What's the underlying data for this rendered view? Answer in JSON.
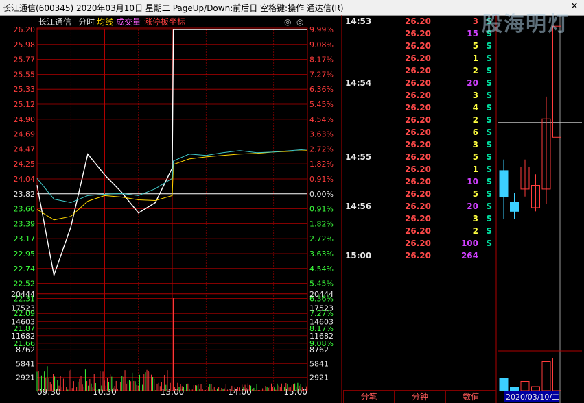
{
  "window": {
    "title": "长江通信(600345)  2020年03月10日 星期二  PageUp/Down:前后日 空格键:操作 通达信(R)",
    "close_glyph": "✕"
  },
  "legend": {
    "name": "长江通信",
    "time_share": "分时",
    "avg_line": "均线",
    "volume": "成交量",
    "limit_axis": "涨停板坐标",
    "icon_glyph": "◎"
  },
  "price_axis_left": [
    "26.20",
    "25.98",
    "25.77",
    "25.55",
    "25.33",
    "25.12",
    "24.90",
    "24.69",
    "24.47",
    "24.25",
    "24.04",
    "23.82",
    "23.60",
    "23.39",
    "23.17",
    "22.95",
    "22.74",
    "22.52",
    "22.31",
    "22.09",
    "21.87",
    "21.66"
  ],
  "pct_axis_right": [
    "9.99%",
    "9.08%",
    "8.17%",
    "7.27%",
    "6.36%",
    "5.45%",
    "4.54%",
    "3.63%",
    "2.72%",
    "1.82%",
    "0.91%",
    "0.00%",
    "0.91%",
    "1.82%",
    "2.72%",
    "3.63%",
    "4.54%",
    "5.45%",
    "6.36%",
    "7.27%",
    "8.17%",
    "9.08%"
  ],
  "volume_axis": [
    "20444",
    "17523",
    "14603",
    "11682",
    "8762",
    "5841",
    "2921"
  ],
  "time_axis": [
    "09:30",
    "10:30",
    "13:00",
    "14:00",
    "15:00"
  ],
  "colors": {
    "up": "#ff3c3c",
    "down": "#3cff3c",
    "grid": "#b00000",
    "price_line": "#ffffff",
    "avg_line": "#ffd700",
    "cyan_line": "#40c8c8",
    "volume_purple": "#d040ff",
    "candle_up": "#ff3c3c",
    "candle_down": "#3cd0ff"
  },
  "tick_rows": [
    {
      "time": "14:53",
      "price": "26.20",
      "vol": "3",
      "dir": "S",
      "vol_color": "#ff4a4a"
    },
    {
      "time": "",
      "price": "26.20",
      "vol": "15",
      "dir": "S",
      "vol_color": "#d040ff"
    },
    {
      "time": "",
      "price": "26.20",
      "vol": "5",
      "dir": "S",
      "vol_color": "#ffff40"
    },
    {
      "time": "",
      "price": "26.20",
      "vol": "1",
      "dir": "S",
      "vol_color": "#ffff40"
    },
    {
      "time": "",
      "price": "26.20",
      "vol": "2",
      "dir": "S",
      "vol_color": "#ffff40"
    },
    {
      "time": "14:54",
      "price": "26.20",
      "vol": "20",
      "dir": "S",
      "vol_color": "#d040ff"
    },
    {
      "time": "",
      "price": "26.20",
      "vol": "3",
      "dir": "S",
      "vol_color": "#ffff40"
    },
    {
      "time": "",
      "price": "26.20",
      "vol": "4",
      "dir": "S",
      "vol_color": "#ffff40"
    },
    {
      "time": "",
      "price": "26.20",
      "vol": "2",
      "dir": "S",
      "vol_color": "#ffff40"
    },
    {
      "time": "",
      "price": "26.20",
      "vol": "6",
      "dir": "S",
      "vol_color": "#ffff40"
    },
    {
      "time": "",
      "price": "26.20",
      "vol": "3",
      "dir": "S",
      "vol_color": "#ffff40"
    },
    {
      "time": "14:55",
      "price": "26.20",
      "vol": "5",
      "dir": "S",
      "vol_color": "#ffff40"
    },
    {
      "time": "",
      "price": "26.20",
      "vol": "1",
      "dir": "S",
      "vol_color": "#ffff40"
    },
    {
      "time": "",
      "price": "26.20",
      "vol": "10",
      "dir": "S",
      "vol_color": "#d040ff"
    },
    {
      "time": "",
      "price": "26.20",
      "vol": "5",
      "dir": "S",
      "vol_color": "#ffff40"
    },
    {
      "time": "14:56",
      "price": "26.20",
      "vol": "20",
      "dir": "S",
      "vol_color": "#d040ff"
    },
    {
      "time": "",
      "price": "26.20",
      "vol": "3",
      "dir": "S",
      "vol_color": "#ffff40"
    },
    {
      "time": "",
      "price": "26.20",
      "vol": "2",
      "dir": "S",
      "vol_color": "#ffff40"
    },
    {
      "time": "",
      "price": "26.20",
      "vol": "100",
      "dir": "S",
      "vol_color": "#d040ff"
    },
    {
      "time": "15:00",
      "price": "26.20",
      "vol": "264",
      "dir": "",
      "vol_color": "#d040ff"
    }
  ],
  "tabs": [
    "分笔",
    "分钟",
    "数值"
  ],
  "kline": {
    "price_label": "26.20",
    "date_label": "2020/03/10/二",
    "candles": [
      {
        "open": 24.25,
        "close": 23.9,
        "high": 24.4,
        "low": 23.6
      },
      {
        "open": 23.82,
        "close": 23.7,
        "high": 23.95,
        "low": 23.6
      },
      {
        "open": 24.0,
        "close": 24.3,
        "high": 24.4,
        "low": 23.9
      },
      {
        "open": 23.75,
        "close": 24.05,
        "high": 24.2,
        "low": 23.7
      },
      {
        "open": 24.0,
        "close": 24.95,
        "high": 25.25,
        "low": 23.8
      },
      {
        "open": 24.7,
        "close": 26.2,
        "high": 26.3,
        "low": 24.4
      }
    ],
    "candle_vol": [
      0.35,
      0.1,
      0.27,
      0.12,
      0.85,
      0.95
    ]
  },
  "watermark": "股海明灯",
  "chart_data": {
    "type": "line",
    "title": "长江通信(600345) 2020年03月10日",
    "prev_close": 23.82,
    "ylim": [
      21.56,
      26.2
    ],
    "x": [
      "09:30",
      "09:45",
      "10:00",
      "10:15",
      "10:30",
      "10:45",
      "11:00",
      "11:15",
      "11:30",
      "13:00",
      "13:15",
      "13:30",
      "13:45",
      "14:00",
      "14:15",
      "14:30",
      "14:45",
      "15:00"
    ],
    "series": [
      {
        "name": "price",
        "values": [
          23.95,
          22.65,
          23.35,
          24.4,
          24.1,
          23.85,
          23.55,
          23.7,
          24.2,
          26.2,
          26.2,
          26.2,
          26.2,
          26.2,
          26.2,
          26.2,
          26.2,
          26.2
        ]
      },
      {
        "name": "均线",
        "values": [
          23.6,
          23.45,
          23.5,
          23.72,
          23.8,
          23.78,
          23.74,
          23.73,
          23.8,
          24.25,
          24.33,
          24.36,
          24.38,
          24.4,
          24.41,
          24.43,
          24.44,
          24.45
        ]
      }
    ]
  }
}
